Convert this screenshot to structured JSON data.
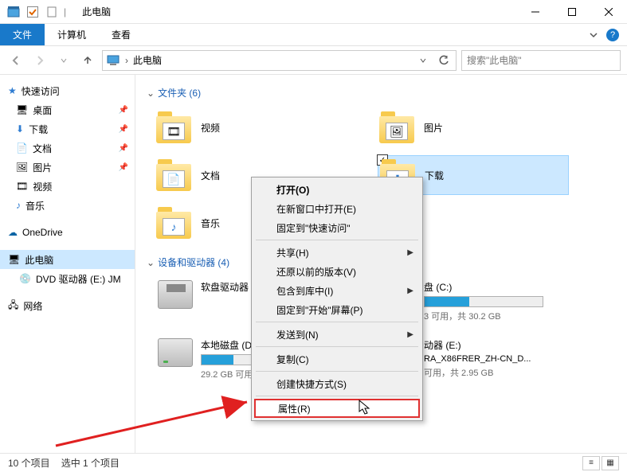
{
  "title": "此电脑",
  "tabs": {
    "file": "文件",
    "computer": "计算机",
    "view": "查看"
  },
  "address": {
    "crumb": "此电脑",
    "search_placeholder": "搜索\"此电脑\""
  },
  "nav": {
    "quick_access": "快速访问",
    "items": [
      {
        "label": "桌面",
        "icon": "desktop"
      },
      {
        "label": "下载",
        "icon": "download"
      },
      {
        "label": "文档",
        "icon": "document"
      },
      {
        "label": "图片",
        "icon": "picture"
      },
      {
        "label": "视频",
        "icon": "video"
      },
      {
        "label": "音乐",
        "icon": "music"
      }
    ],
    "onedrive": "OneDrive",
    "this_pc": "此电脑",
    "dvd": "DVD 驱动器 (E:) JM",
    "network": "网络"
  },
  "sections": {
    "folders_header": "文件夹 (6)",
    "devices_header": "设备和驱动器 (4)"
  },
  "folders": [
    {
      "label": "视频"
    },
    {
      "label": "图片"
    },
    {
      "label": "文档"
    },
    {
      "label": "下载",
      "selected": true
    },
    {
      "label": "音乐"
    }
  ],
  "drives": [
    {
      "name": "软盘驱动器 (A",
      "type": "floppy"
    },
    {
      "name": "盘 (C:)",
      "type": "hdd",
      "fill": 38,
      "free": "3 可用，共 30.2 GB"
    },
    {
      "name": "本地磁盘 (D:)",
      "type": "hdd",
      "fill": 27,
      "free": "29.2 GB 可用"
    },
    {
      "name": "动器 (E:)",
      "sub": "RA_X86FRER_ZH-CN_D...",
      "type": "dvd",
      "free": "可用，共 2.95 GB"
    }
  ],
  "context_menu": [
    {
      "label": "打开(O)",
      "bold": true
    },
    {
      "label": "在新窗口中打开(E)"
    },
    {
      "label": "固定到\"快速访问\""
    },
    {
      "sep": true
    },
    {
      "label": "共享(H)",
      "arrow": true
    },
    {
      "label": "还原以前的版本(V)"
    },
    {
      "label": "包含到库中(I)",
      "arrow": true
    },
    {
      "label": "固定到\"开始\"屏幕(P)"
    },
    {
      "sep": true
    },
    {
      "label": "发送到(N)",
      "arrow": true
    },
    {
      "sep": true
    },
    {
      "label": "复制(C)"
    },
    {
      "sep": true
    },
    {
      "label": "创建快捷方式(S)"
    },
    {
      "sep": true
    },
    {
      "label": "属性(R)",
      "hl": true
    }
  ],
  "status": {
    "count": "10 个项目",
    "selected": "选中 1 个项目"
  }
}
